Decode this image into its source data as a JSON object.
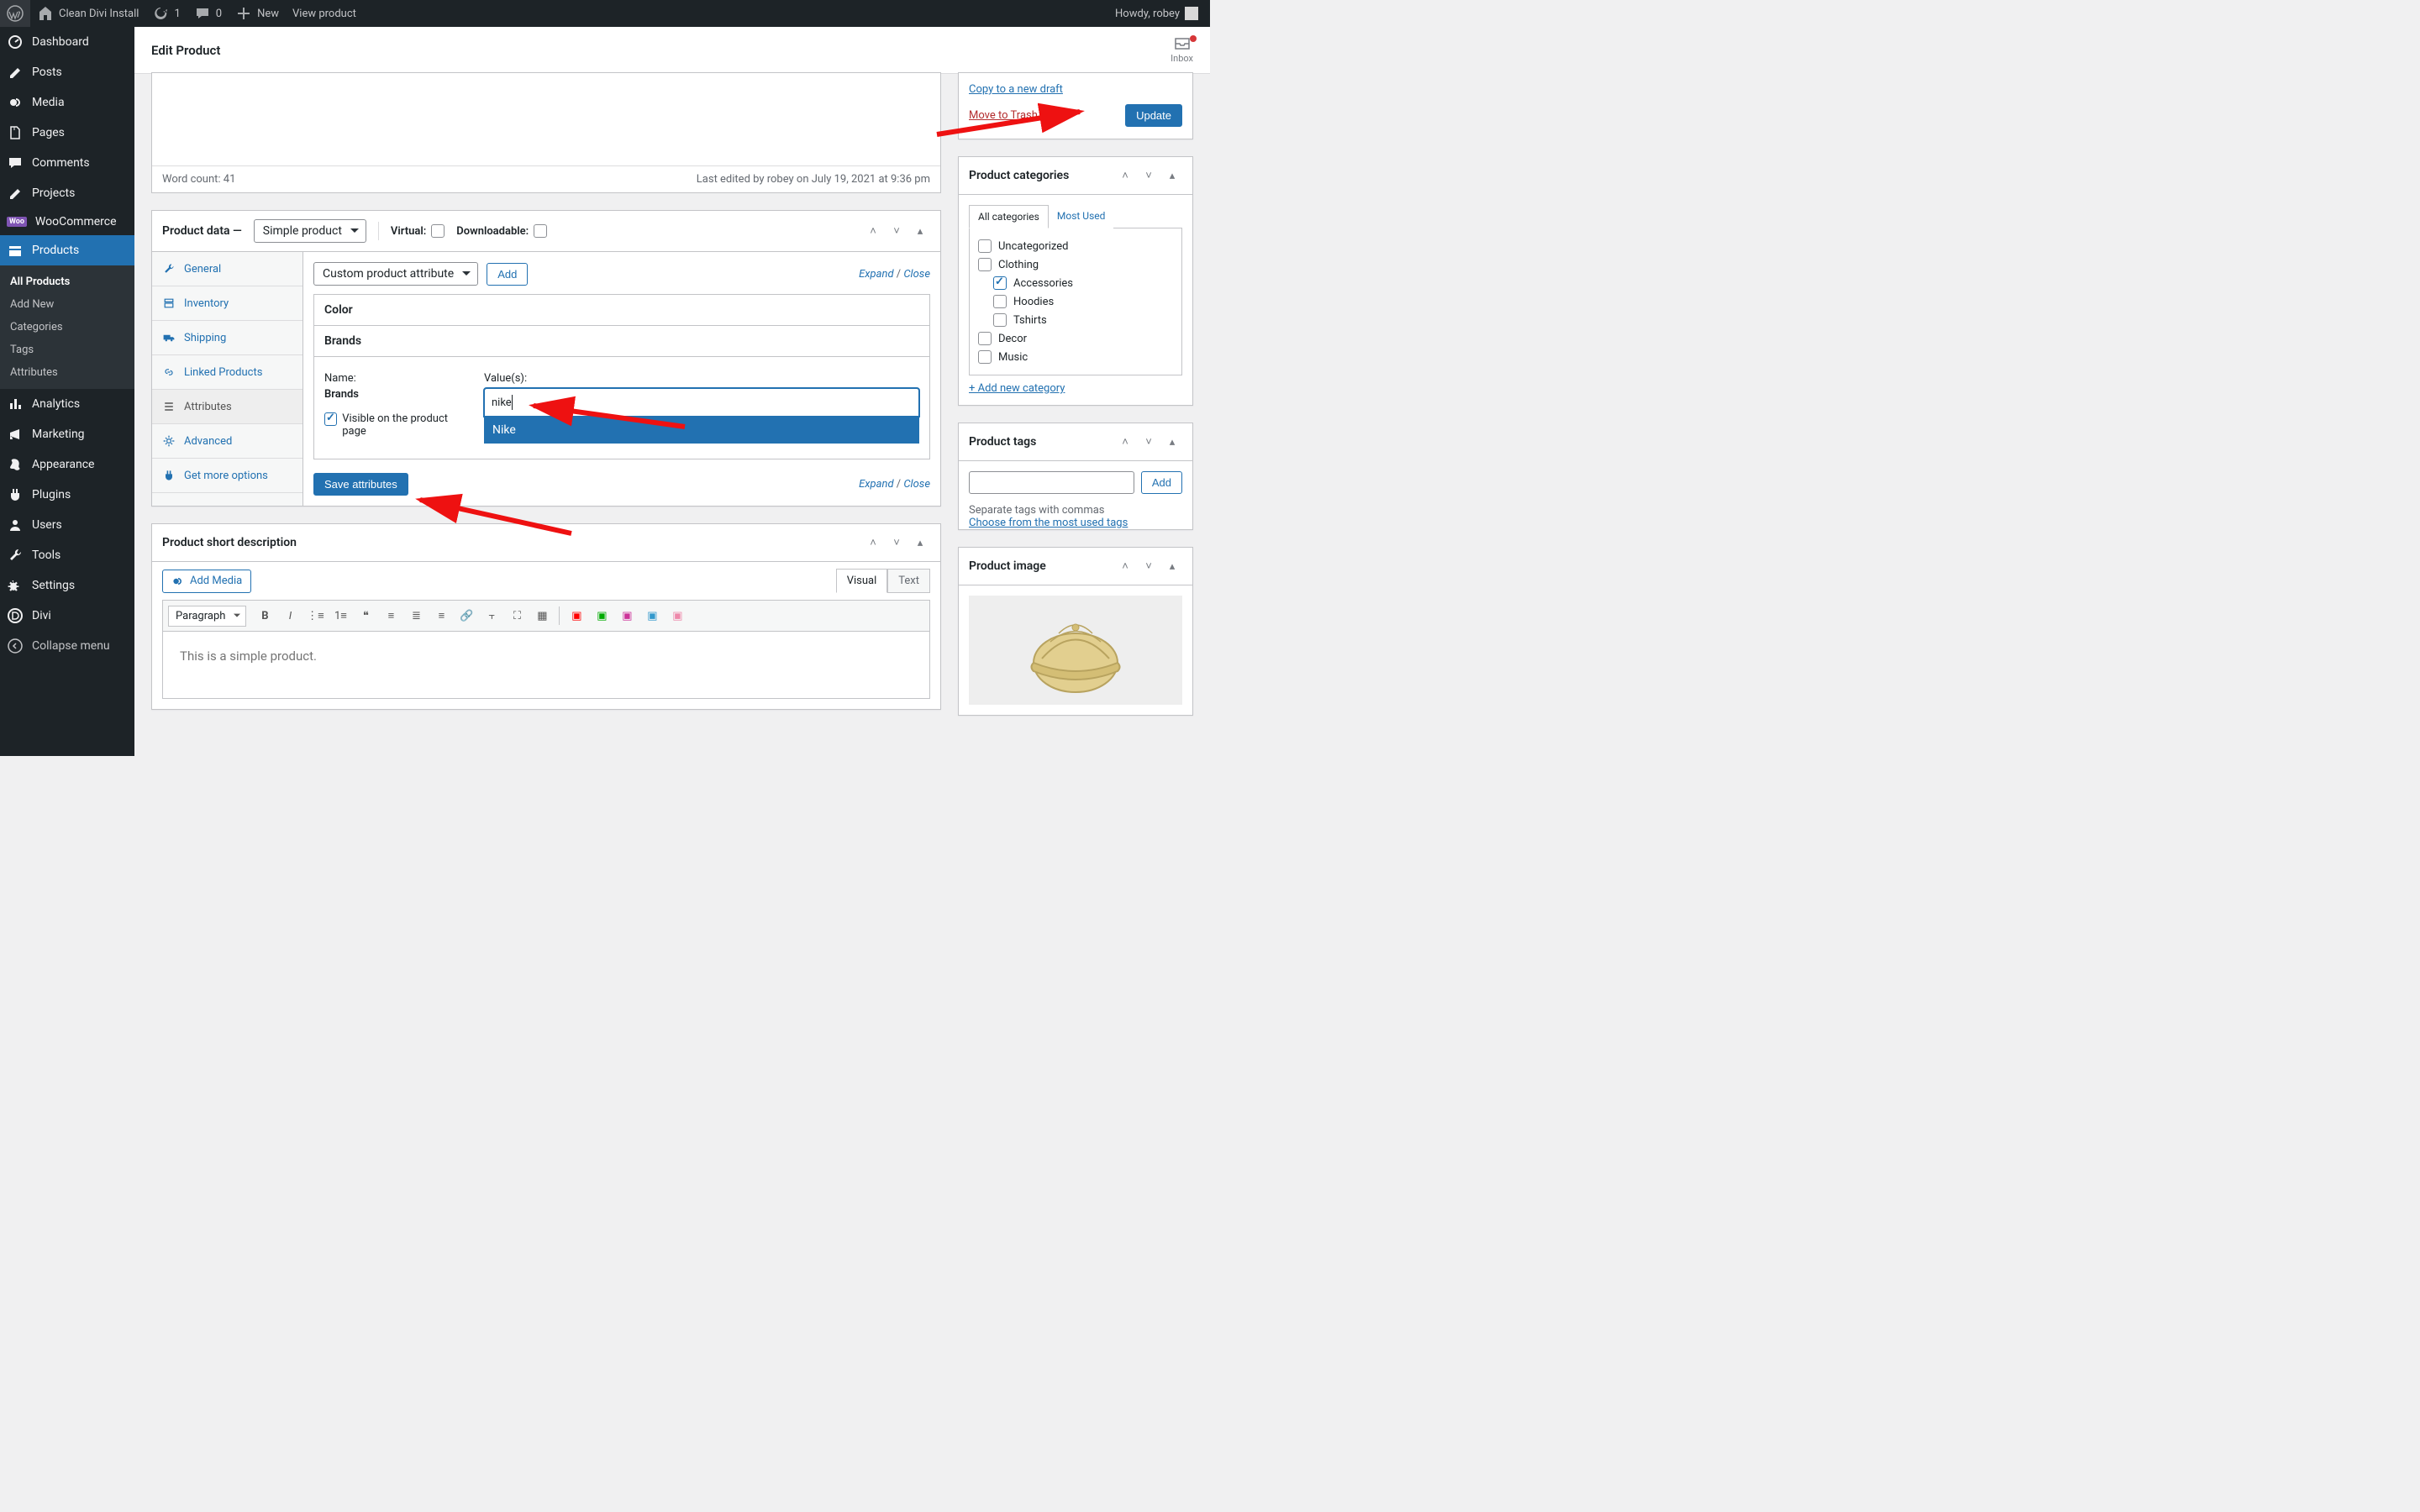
{
  "adminbar": {
    "site_name": "Clean Divi Install",
    "updates": "1",
    "comments": "0",
    "new": "New",
    "view_product": "View product",
    "howdy": "Howdy, robey"
  },
  "sidebar": {
    "dashboard": "Dashboard",
    "posts": "Posts",
    "media": "Media",
    "pages": "Pages",
    "comments": "Comments",
    "projects": "Projects",
    "woocommerce": "WooCommerce",
    "products": "Products",
    "submenu": {
      "all_products": "All Products",
      "add_new": "Add New",
      "categories": "Categories",
      "tags": "Tags",
      "attributes": "Attributes"
    },
    "analytics": "Analytics",
    "marketing": "Marketing",
    "appearance": "Appearance",
    "plugins": "Plugins",
    "users": "Users",
    "tools": "Tools",
    "settings": "Settings",
    "divi": "Divi",
    "collapse": "Collapse menu"
  },
  "page": {
    "title": "Edit Product",
    "inbox": "Inbox"
  },
  "editor_status": {
    "word_count": "Word count: 41",
    "last_edited": "Last edited by robey on July 19, 2021 at 9:36 pm"
  },
  "product_data": {
    "title": "Product data",
    "type_select": "Simple product",
    "virtual": "Virtual:",
    "downloadable": "Downloadable:",
    "tabs": {
      "general": "General",
      "inventory": "Inventory",
      "shipping": "Shipping",
      "linked": "Linked Products",
      "attributes": "Attributes",
      "advanced": "Advanced",
      "more": "Get more options"
    },
    "attribute_select": "Custom product attribute",
    "add": "Add",
    "expand": "Expand",
    "close": "Close",
    "attr_color": "Color",
    "attr_brands": "Brands",
    "name_label": "Name:",
    "name_value": "Brands",
    "visible": "Visible on the product page",
    "values_label": "Value(s):",
    "search_value": "nike",
    "dropdown_option": "Nike",
    "save": "Save attributes"
  },
  "short_desc": {
    "title": "Product short description",
    "add_media": "Add Media",
    "visual": "Visual",
    "text": "Text",
    "paragraph": "Paragraph",
    "body": "This is a simple product."
  },
  "publish": {
    "copy": "Copy to a new draft",
    "trash": "Move to Trash",
    "update": "Update"
  },
  "categories": {
    "title": "Product categories",
    "all": "All categories",
    "most_used": "Most Used",
    "items": {
      "uncategorized": "Uncategorized",
      "clothing": "Clothing",
      "accessories": "Accessories",
      "hoodies": "Hoodies",
      "tshirts": "Tshirts",
      "decor": "Decor",
      "music": "Music"
    },
    "add_new": "+ Add new category"
  },
  "tags": {
    "title": "Product tags",
    "add": "Add",
    "hint": "Separate tags with commas",
    "choose": "Choose from the most used tags"
  },
  "image": {
    "title": "Product image"
  }
}
